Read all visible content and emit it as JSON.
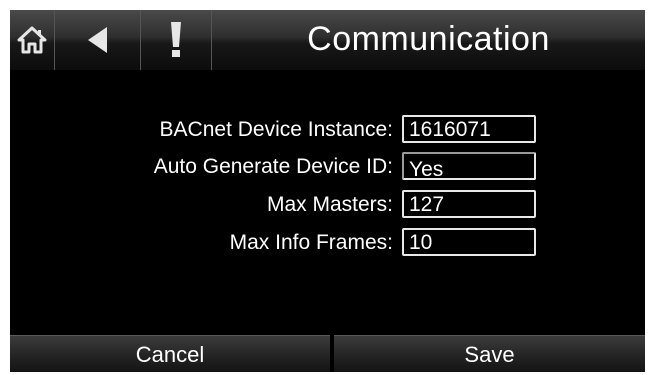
{
  "header": {
    "title": "Communication",
    "icons": {
      "home": "home-icon",
      "back": "back-arrow-icon",
      "alert": "exclamation-icon"
    }
  },
  "form": {
    "fields": [
      {
        "label": "BACnet Device Instance:",
        "value": "1616071"
      },
      {
        "label": "Auto Generate Device ID:",
        "value": "Yes"
      },
      {
        "label": "Max Masters:",
        "value": "127"
      },
      {
        "label": "Max Info Frames:",
        "value": "10"
      }
    ]
  },
  "footer": {
    "cancel_label": "Cancel",
    "save_label": "Save"
  }
}
